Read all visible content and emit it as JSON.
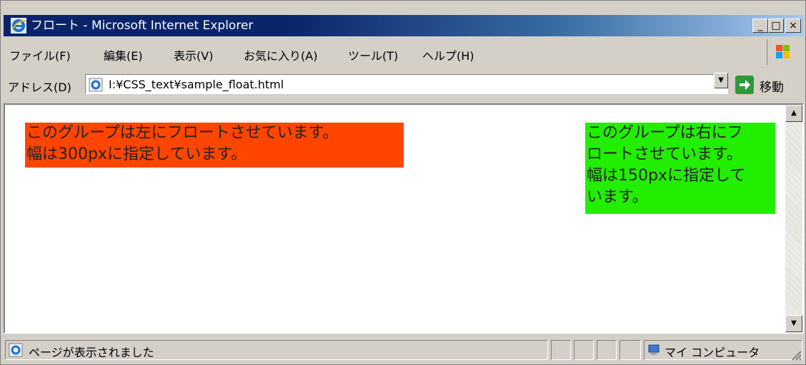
{
  "window": {
    "title": "フロート - Microsoft Internet Explorer",
    "controls": {
      "minimize": "_",
      "maximize": "□",
      "close": "×"
    }
  },
  "menubar": {
    "items": [
      "ファイル(F)",
      "編集(E)",
      "表示(V)",
      "お気に入り(A)",
      "ツール(T)",
      "ヘルプ(H)"
    ]
  },
  "addressbar": {
    "label": "アドレス(D)",
    "url": "I:¥CSS_text¥sample_float.html",
    "go_label": "移動"
  },
  "content": {
    "left_box": {
      "lines": [
        "このグループは左にフロートさせています。",
        "幅は300pxに指定しています。"
      ],
      "bg_color": "#ff4500"
    },
    "right_box": {
      "lines": [
        "このグループは右にフ",
        "ロートさせています。",
        "幅は150pxに指定して",
        "います。"
      ],
      "bg_color": "#22ee00"
    }
  },
  "statusbar": {
    "text": "ページが表示されました",
    "zone": "マイ コンピュータ"
  },
  "colors": {
    "titlebar": "#0a246a",
    "chrome": "#d4d0c8"
  }
}
